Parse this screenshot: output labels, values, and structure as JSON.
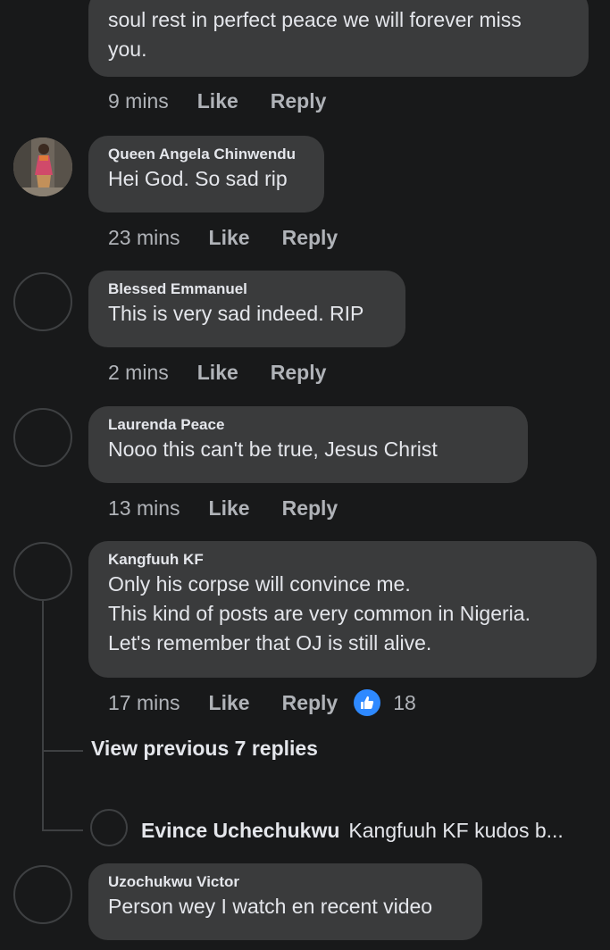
{
  "comments": [
    {
      "author": "",
      "lines": [
        "soul rest in perfect peace we will forever miss",
        "you."
      ],
      "time": "9 mins",
      "like": "Like",
      "reply": "Reply"
    },
    {
      "author": "Queen Angela Chinwendu",
      "lines": [
        "Hei God. So sad rip"
      ],
      "time": "23 mins",
      "like": "Like",
      "reply": "Reply"
    },
    {
      "author": "Blessed Emmanuel",
      "lines": [
        "This is very sad indeed. RIP"
      ],
      "time": "2 mins",
      "like": "Like",
      "reply": "Reply"
    },
    {
      "author": "Laurenda Peace",
      "lines": [
        "Nooo this can't be true, Jesus Christ"
      ],
      "time": "13 mins",
      "like": "Like",
      "reply": "Reply"
    },
    {
      "author": "Kangfuuh KF",
      "lines": [
        "Only his corpse will convince me.",
        "This kind of posts are very common in Nigeria.",
        "Let's remember that OJ is still alive."
      ],
      "time": "17 mins",
      "like": "Like",
      "reply": "Reply",
      "reaction_count": "18"
    },
    {
      "author": "Uzochukwu Victor",
      "lines": [
        "Person wey I watch en recent video"
      ]
    }
  ],
  "view_previous_replies": "View previous 7 replies",
  "reply_preview": {
    "author": "Evince Uchechukwu",
    "text": "Kangfuuh KF kudos b..."
  },
  "colors": {
    "background": "#18191a",
    "bubble": "#3a3b3c",
    "secondary_text": "#b0b3b8",
    "like_blue": "#2e89ff"
  },
  "icons": {
    "like_reaction": "thumbs-up-icon"
  }
}
